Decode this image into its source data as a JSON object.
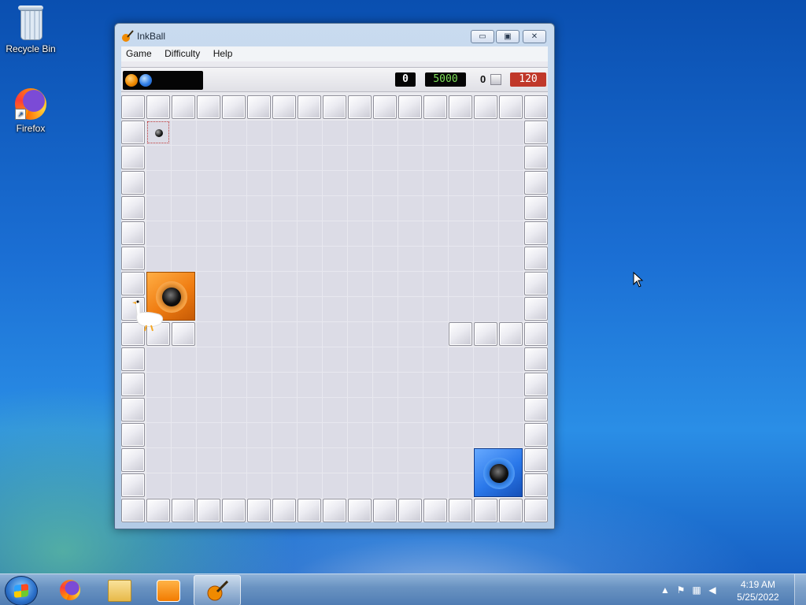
{
  "desktop": {
    "icons": [
      {
        "label": "Recycle Bin",
        "icon": "recycle-bin-icon"
      },
      {
        "label": "Firefox",
        "icon": "firefox-icon"
      }
    ]
  },
  "window": {
    "title": "InkBall",
    "controls": {
      "minimize": "▭",
      "maximize": "▣",
      "close": "✕"
    },
    "menu": [
      {
        "label": "Game"
      },
      {
        "label": "Difficulty"
      },
      {
        "label": "Help"
      }
    ]
  },
  "scorebar": {
    "ball_queue": [
      "orange",
      "blue"
    ],
    "score": "0",
    "high_score": "5000",
    "misses": "0",
    "timer": "120",
    "colors": {
      "score_text": "#ffffff",
      "high_score_text": "#7ee05a",
      "timer_bg": "#c0382a"
    }
  },
  "board": {
    "rows": 17,
    "cols": 17,
    "inner_walls": [
      [
        9,
        1
      ],
      [
        9,
        2
      ],
      [
        9,
        13
      ],
      [
        9,
        14
      ],
      [
        9,
        15
      ]
    ],
    "holes": [
      {
        "color": "orange",
        "row": 7,
        "col": 1
      },
      {
        "color": "blue",
        "row": 14,
        "col": 14
      }
    ],
    "spawn": {
      "row": 1,
      "col": 1
    },
    "goose": {
      "row": 8,
      "col": 0
    }
  },
  "taskbar": {
    "apps": [
      {
        "icon": "firefox-icon"
      },
      {
        "icon": "file-explorer-icon"
      },
      {
        "icon": "media-player-icon"
      },
      {
        "icon": "inkball-icon",
        "active": true
      }
    ],
    "tray_icons": [
      "show-hidden-icons-icon",
      "action-center-flag-icon",
      "network-icon",
      "volume-muted-icon"
    ],
    "time": "4:19 AM",
    "date": "5/25/2022"
  }
}
